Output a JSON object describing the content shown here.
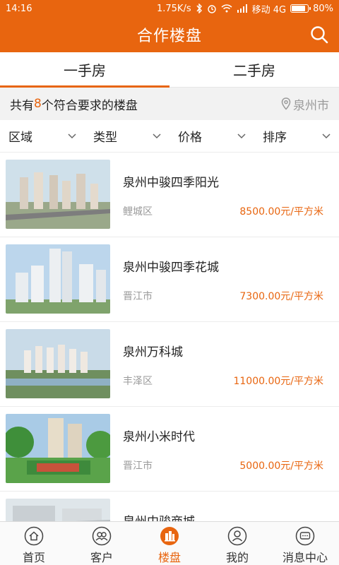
{
  "status": {
    "time": "14:16",
    "speed": "1.75K/s",
    "carrier": "移动 4G",
    "battery": "80%",
    "battery_level": 0.8
  },
  "header": {
    "title": "合作楼盘"
  },
  "tabs": [
    {
      "label": "一手房"
    },
    {
      "label": "二手房"
    }
  ],
  "summary": {
    "prefix": "共有",
    "count": "8",
    "suffix": "个符合要求的楼盘",
    "location": "泉州市"
  },
  "filters": [
    {
      "label": "区域"
    },
    {
      "label": "类型"
    },
    {
      "label": "价格"
    },
    {
      "label": "排序"
    }
  ],
  "listings": [
    {
      "name": "泉州中骏四季阳光",
      "district": "鲤城区",
      "price": "8500.00元/平方米"
    },
    {
      "name": "泉州中骏四季花城",
      "district": "晋江市",
      "price": "7300.00元/平方米"
    },
    {
      "name": "泉州万科城",
      "district": "丰泽区",
      "price": "11000.00元/平方米"
    },
    {
      "name": "泉州小米时代",
      "district": "晋江市",
      "price": "5000.00元/平方米"
    },
    {
      "name": "泉州中骏商城",
      "district": "",
      "price": ""
    }
  ],
  "nav": [
    {
      "label": "首页"
    },
    {
      "label": "客户"
    },
    {
      "label": "楼盘"
    },
    {
      "label": "我的"
    },
    {
      "label": "消息中心"
    }
  ],
  "colors": {
    "accent": "#e8650f",
    "muted": "#9a9a9a"
  },
  "icons": {
    "search": "search-icon",
    "location": "location-pin-icon",
    "home": "home-icon",
    "customer": "customers-icon",
    "buildings": "buildings-icon",
    "profile": "profile-icon",
    "message": "message-icon"
  }
}
